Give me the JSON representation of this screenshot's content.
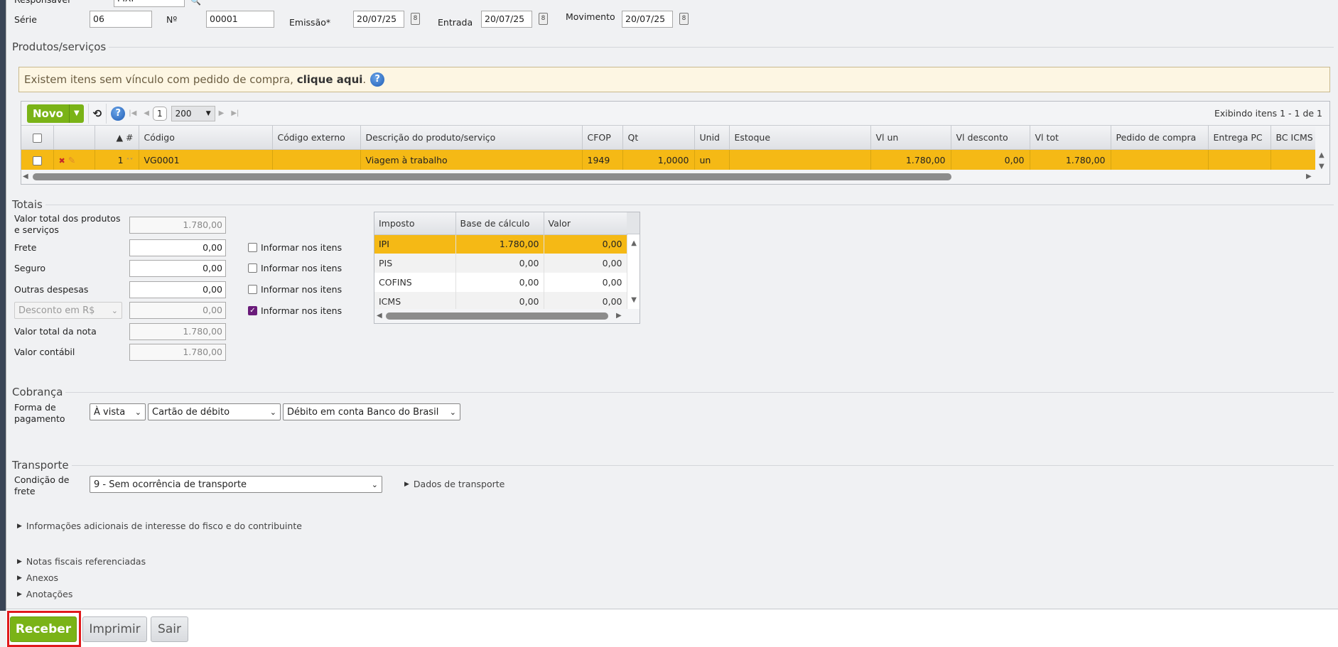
{
  "header": {
    "responsavel_label": "Responsável",
    "responsavel_value": "FIXI",
    "serie_label": "Série",
    "serie_value": "06",
    "numero_label": "Nº",
    "numero_value": "00001",
    "emissao_label": "Emissão*",
    "emissao_value": "20/07/25",
    "entrada_label": "Entrada",
    "entrada_value": "20/07/25",
    "movimento_label": "Movimento",
    "movimento_value": "20/07/25"
  },
  "produtos": {
    "legend": "Produtos/serviços",
    "alert_text": "Existem itens sem vínculo com pedido de compra, ",
    "alert_link": "clique aqui",
    "alert_end": ".",
    "toolbar": {
      "novo_label": "Novo",
      "page": "1",
      "page_size": "200",
      "showing": "Exibindo itens 1 - 1 de 1"
    },
    "columns": [
      "",
      "",
      "▲ #",
      "Código",
      "Código externo",
      "Descrição do produto/serviço",
      "CFOP",
      "Qt",
      "Unid",
      "Estoque",
      "Vl un",
      "Vl desconto",
      "Vl tot",
      "Pedido de compra",
      "Entrega PC",
      "BC ICMS"
    ],
    "rows": [
      {
        "num": "1",
        "codigo": "VG0001",
        "codigo_externo": "",
        "descricao": "Viagem à trabalho",
        "cfop": "1949",
        "qt": "1,0000",
        "unid": "un",
        "estoque": "",
        "vl_un": "1.780,00",
        "vl_desconto": "0,00",
        "vl_tot": "1.780,00",
        "pedido": "",
        "entrega": "",
        "bc_icms": ""
      }
    ]
  },
  "totais": {
    "legend": "Totais",
    "fields": [
      {
        "label": "Valor total dos produtos e serviços",
        "value": "1.780,00"
      },
      {
        "label": "Frete",
        "value": "0,00",
        "informar": false
      },
      {
        "label": "Seguro",
        "value": "0,00",
        "informar": false
      },
      {
        "label": "Outras despesas",
        "value": "0,00",
        "informar": false
      },
      {
        "label": "Desconto em R$",
        "value": "0,00",
        "informar": true
      },
      {
        "label": "Valor total da nota",
        "value": "1.780,00"
      },
      {
        "label": "Valor contábil",
        "value": "1.780,00"
      }
    ],
    "informar_label": "Informar nos itens",
    "tax_columns": [
      "Imposto",
      "Base de cálculo",
      "Valor"
    ],
    "taxes": [
      {
        "imposto": "IPI",
        "base": "1.780,00",
        "valor": "0,00"
      },
      {
        "imposto": "PIS",
        "base": "0,00",
        "valor": "0,00"
      },
      {
        "imposto": "COFINS",
        "base": "0,00",
        "valor": "0,00"
      },
      {
        "imposto": "ICMS",
        "base": "0,00",
        "valor": "0,00"
      }
    ]
  },
  "cobranca": {
    "legend": "Cobrança",
    "forma_label": "Forma de pagamento",
    "prazo": "À vista",
    "meio": "Cartão de débito",
    "conta": "Débito em conta Banco do Brasil"
  },
  "transporte": {
    "legend": "Transporte",
    "condicao_label": "Condição de frete",
    "condicao_value": "9 - Sem ocorrência de transporte",
    "dados_label": "Dados de transporte"
  },
  "sections": {
    "info_adicionais": "Informações adicionais de interesse do fisco e do contribuinte",
    "notas_ref": "Notas fiscais referenciadas",
    "anexos": "Anexos",
    "anotacoes": "Anotações"
  },
  "actions": {
    "receber": "Receber",
    "imprimir": "Imprimir",
    "sair": "Sair"
  },
  "colors": {
    "accent_green": "#7ab317",
    "selected_row": "#f5b915",
    "highlight": "#e0191c"
  }
}
